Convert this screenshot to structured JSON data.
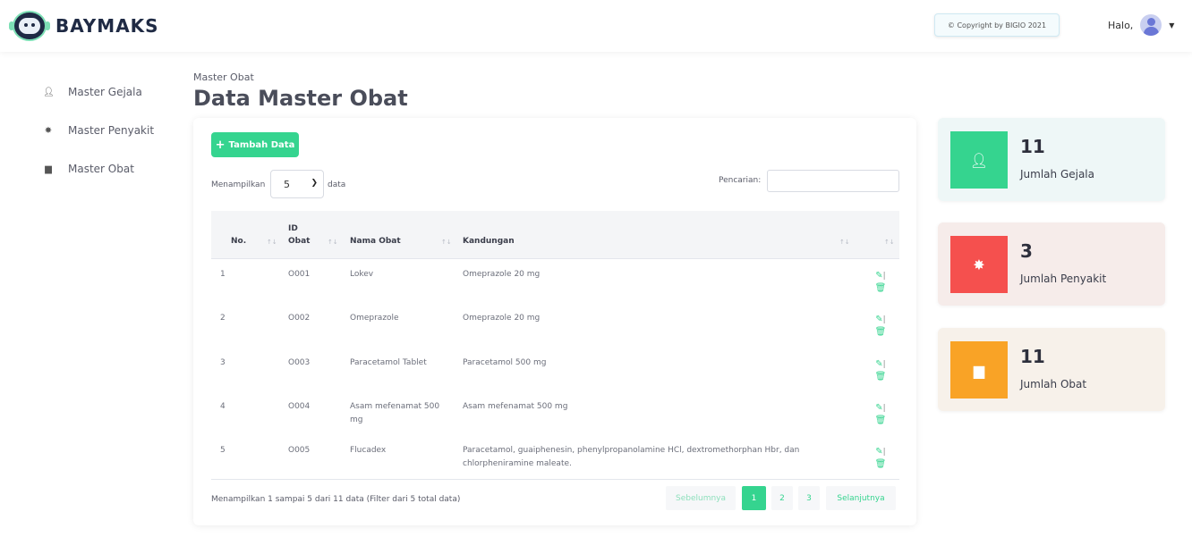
{
  "topbar": {
    "brand": "BAYMAKS",
    "copyright": "© Copyright by BIGIO 2021",
    "greeting": "Halo,"
  },
  "sidebar": {
    "items": [
      {
        "label": "Master Gejala",
        "icon": "user-icon"
      },
      {
        "label": "Master Penyakit",
        "icon": "virus-icon"
      },
      {
        "label": "Master Obat",
        "icon": "pill-bottle-icon"
      }
    ]
  },
  "page": {
    "breadcrumb": "Master Obat",
    "title": "Data Master Obat"
  },
  "toolbar": {
    "add_label": "Tambah Data",
    "show_label": "Menampilkan",
    "page_size": "5",
    "data_label": "data",
    "search_label": "Pencarian:",
    "search_value": ""
  },
  "table": {
    "headers": {
      "no": "No.",
      "id_line1": "ID",
      "id_line2": "Obat",
      "name": "Nama Obat",
      "kandungan": "Kandungan"
    },
    "rows": [
      {
        "no": "1",
        "id": "O001",
        "name": "Lokev",
        "kandungan": "Omeprazole 20 mg"
      },
      {
        "no": "2",
        "id": "O002",
        "name": "Omeprazole",
        "kandungan": "Omeprazole 20 mg"
      },
      {
        "no": "3",
        "id": "O003",
        "name": "Paracetamol Tablet",
        "kandungan": "Paracetamol 500 mg"
      },
      {
        "no": "4",
        "id": "O004",
        "name": "Asam mefenamat 500 mg",
        "kandungan": "Asam mefenamat 500 mg"
      },
      {
        "no": "5",
        "id": "O005",
        "name": "Flucadex",
        "kandungan": "Paracetamol, guaiphenesin, phenylpropanolamine HCl, dextromethorphan Hbr, dan chlorpheniramine maleate."
      }
    ],
    "action_separator": "|"
  },
  "footer": {
    "info": "Menampilkan 1 sampai 5 dari 11 data (Filter dari 5 total data)",
    "prev": "Sebelumnya",
    "pages": [
      "1",
      "2",
      "3"
    ],
    "next": "Selanjutnya"
  },
  "stats": [
    {
      "value": "11",
      "label": "Jumlah Gejala",
      "icon": "user-arrow-icon",
      "color": "#35d48f",
      "bg": "#eef7f7"
    },
    {
      "value": "3",
      "label": "Jumlah Penyakit",
      "icon": "virus-icon",
      "color": "#f5504e",
      "bg": "#f6ecea"
    },
    {
      "value": "11",
      "label": "Jumlah Obat",
      "icon": "pill-bottle-icon",
      "color": "#f9a326",
      "bg": "#f7f1ea"
    }
  ],
  "colors": {
    "accent": "#35d48f",
    "brand_dark": "#1f2a44"
  }
}
